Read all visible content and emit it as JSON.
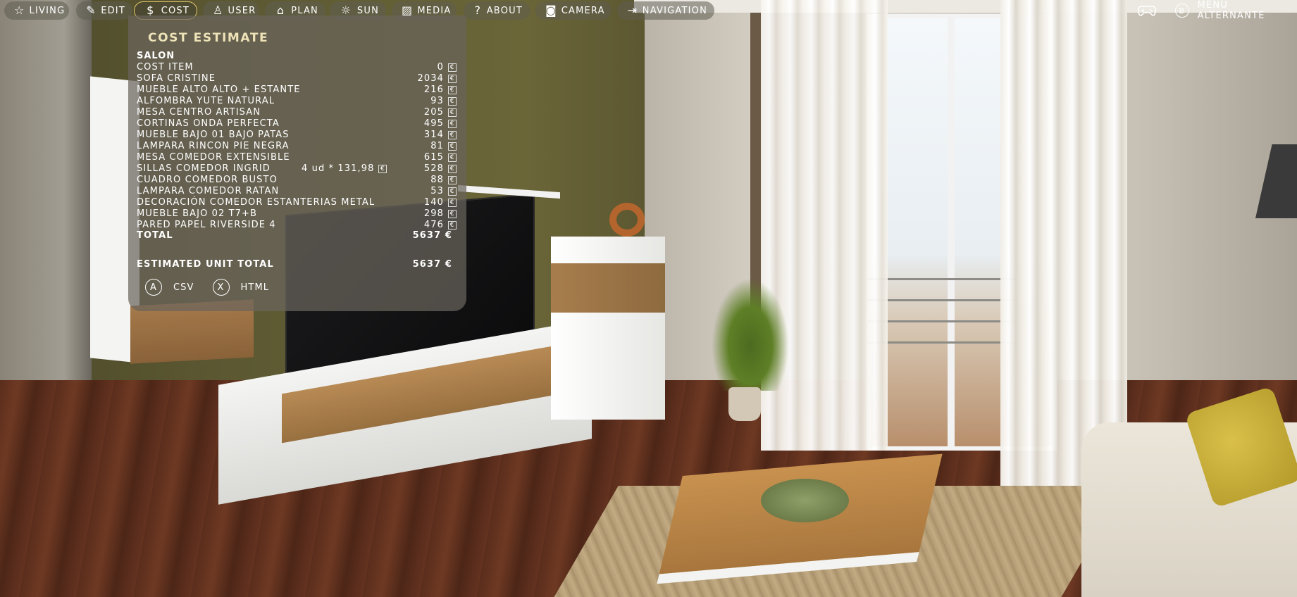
{
  "nav": {
    "items": [
      {
        "label": "LIVING",
        "icon": "star-icon",
        "glyph": "☆"
      },
      {
        "label": "EDIT",
        "icon": "edit-icon",
        "glyph": "✎"
      },
      {
        "label": "COST",
        "icon": "dollar-icon",
        "glyph": "$"
      },
      {
        "label": "USER",
        "icon": "user-icon",
        "glyph": "♙"
      },
      {
        "label": "PLAN",
        "icon": "plan-icon",
        "glyph": "⌂"
      },
      {
        "label": "SUN",
        "icon": "sun-icon",
        "glyph": "☼"
      },
      {
        "label": "MEDIA",
        "icon": "image-icon",
        "glyph": "▨"
      },
      {
        "label": "ABOUT",
        "icon": "question-icon",
        "glyph": "?"
      },
      {
        "label": "CAMERA",
        "icon": "camera-icon",
        "glyph": "◙"
      },
      {
        "label": "NAVIGATION",
        "icon": "exit-icon",
        "glyph": "⇥"
      }
    ],
    "active": "COST",
    "active_color": "#e5c86a",
    "controller_icon": "gamepad-icon",
    "alt_menu": {
      "button": "B",
      "label": "MENÚ ALTERNANTE"
    }
  },
  "cost": {
    "title": "COST ESTIMATE",
    "section": "SALON",
    "currency_symbol": "€",
    "items": [
      {
        "name": "COST ITEM",
        "qty": "",
        "value": "0"
      },
      {
        "name": "SOFA CRISTINE",
        "qty": "",
        "value": "2034"
      },
      {
        "name": "MUEBLE ALTO ALTO + ESTANTE",
        "qty": "",
        "value": "216"
      },
      {
        "name": "ALFOMBRA YUTE NATURAL",
        "qty": "",
        "value": "93"
      },
      {
        "name": "MESA CENTRO ARTISAN",
        "qty": "",
        "value": "205"
      },
      {
        "name": "CORTINAS ONDA PERFECTA",
        "qty": "",
        "value": "495"
      },
      {
        "name": "MUEBLE BAJO 01 BAJO PATAS",
        "qty": "",
        "value": "314"
      },
      {
        "name": "LAMPARA RINCON PIE NEGRA",
        "qty": "",
        "value": "81"
      },
      {
        "name": "MESA COMEDOR EXTENSIBLE",
        "qty": "",
        "value": "615"
      },
      {
        "name": "SILLAS COMEDOR INGRID",
        "qty": "4 ud * 131,98",
        "value": "528"
      },
      {
        "name": "CUADRO COMEDOR BUSTO",
        "qty": "",
        "value": "88"
      },
      {
        "name": "LAMPARA COMEDOR RATAN",
        "qty": "",
        "value": "53"
      },
      {
        "name": "DECORACIÓN COMEDOR ESTANTERIAS METAL",
        "qty": "",
        "value": "140"
      },
      {
        "name": "MUEBLE BAJO 02 T7+B",
        "qty": "",
        "value": "298"
      },
      {
        "name": "PARED PAPEL RIVERSIDE 4",
        "qty": "",
        "value": "476"
      }
    ],
    "total_label": "TOTAL",
    "total_value": "5637 €",
    "estimated_label": "ESTIMATED UNIT TOTAL",
    "estimated_value": "5637 €",
    "exports": [
      {
        "button": "A",
        "label": "CSV"
      },
      {
        "button": "X",
        "label": "HTML"
      }
    ]
  }
}
